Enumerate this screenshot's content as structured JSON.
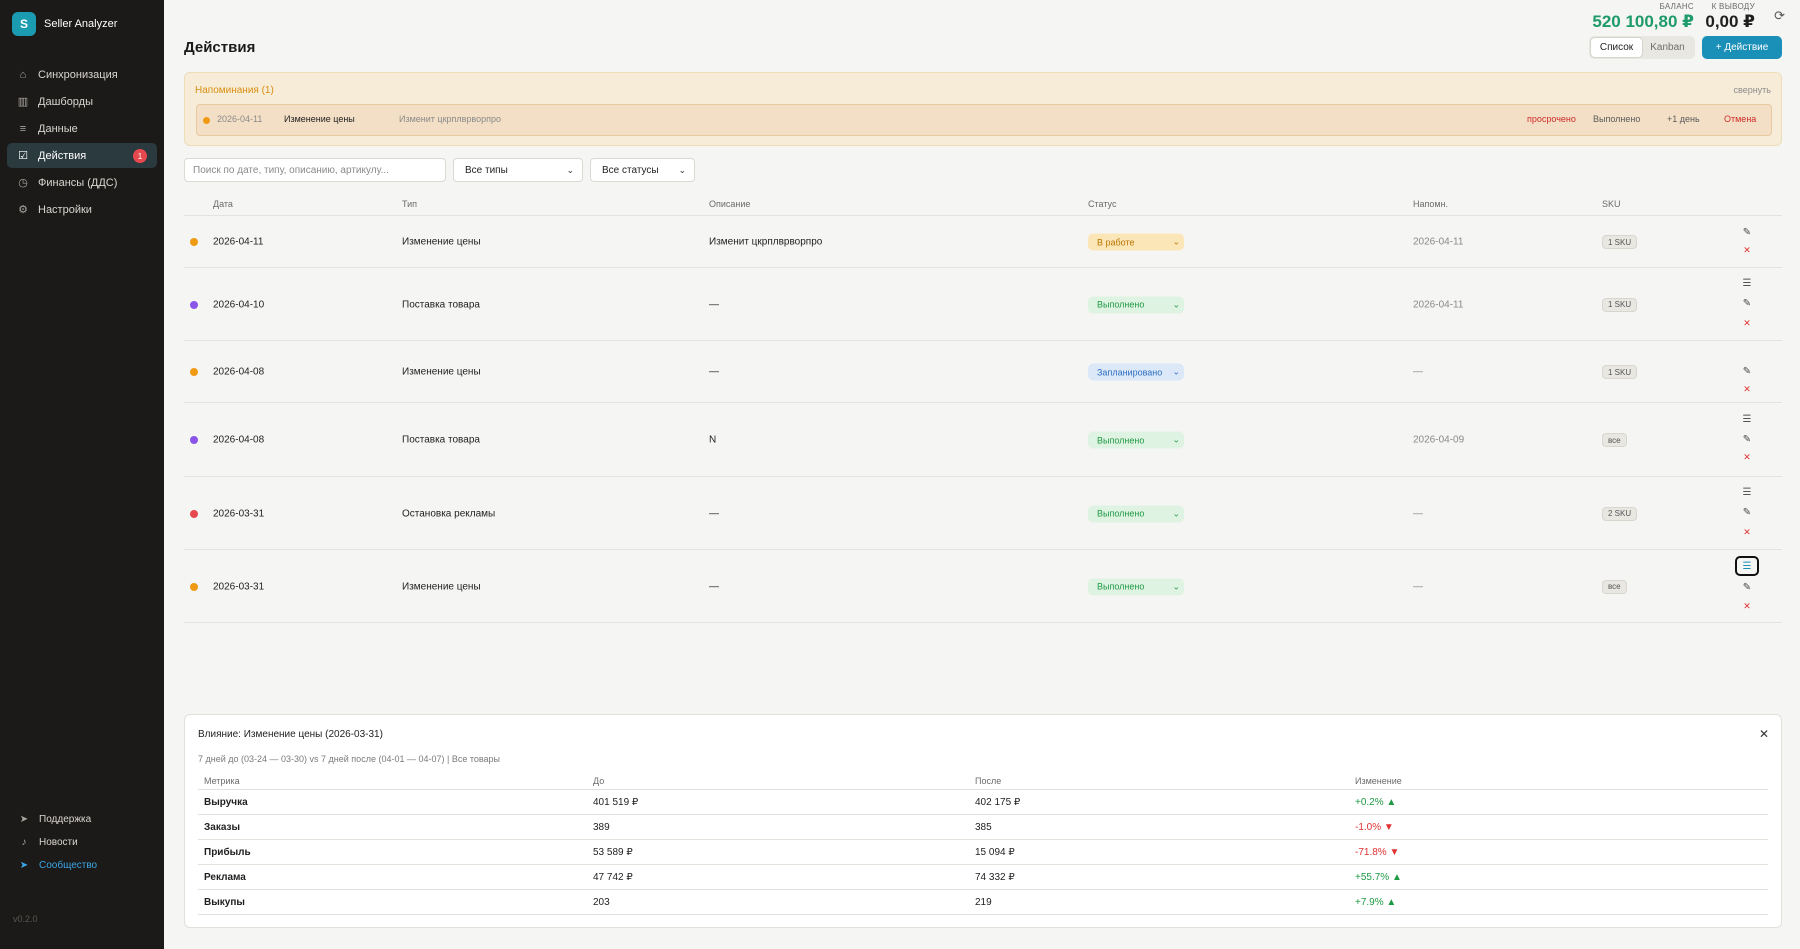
{
  "app": {
    "logo_letter": "S",
    "name": "Seller Analyzer",
    "version": "v0.2.0"
  },
  "sidebar": {
    "items": [
      {
        "label": "Синхронизация",
        "icon": "home-icon",
        "glyph": "⌂",
        "active": false
      },
      {
        "label": "Дашборды",
        "icon": "bar-chart-icon",
        "glyph": "▥",
        "active": false
      },
      {
        "label": "Данные",
        "icon": "list-icon",
        "glyph": "≡",
        "active": false
      },
      {
        "label": "Действия",
        "icon": "clipboard-check-icon",
        "glyph": "☑",
        "active": true,
        "badge": "1"
      },
      {
        "label": "Финансы (ДДС)",
        "icon": "clock-icon",
        "glyph": "◷",
        "active": false
      },
      {
        "label": "Настройки",
        "icon": "gear-icon",
        "glyph": "⚙",
        "active": false
      }
    ],
    "bottom": [
      {
        "label": "Поддержка",
        "icon": "send-icon",
        "glyph": "➤"
      },
      {
        "label": "Новости",
        "icon": "bell-icon",
        "glyph": "♪"
      },
      {
        "label": "Сообщество",
        "icon": "telegram-icon",
        "glyph": "➤",
        "accent": true
      }
    ]
  },
  "header": {
    "balance_caption": "БАЛАНС",
    "balance_value": "520 100,80 ₽",
    "withdraw_caption": "К ВЫВОДУ",
    "withdraw_value": "0,00 ₽",
    "page_title": "Действия",
    "view_list": "Список",
    "view_kanban": "Kanban",
    "add_label": "+ Действие"
  },
  "colors": {
    "accent": "#1a8fb8",
    "balance_green": "#1f9a6a",
    "danger": "#e03131",
    "success": "#1f9a45"
  },
  "reminders": {
    "title": "Напоминания (1)",
    "collapse_label": "свернуть",
    "items": [
      {
        "date": "2026-04-11",
        "type": "Изменение цены",
        "description": "Изменит цкрплврворпро",
        "overdue": "просрочено",
        "done": "Выполнено",
        "plus_day": "+1 день",
        "cancel": "Отмена"
      }
    ]
  },
  "filters": {
    "search_placeholder": "Поиск по дате, типу, описанию, артикулу...",
    "type_select": "Все типы",
    "status_select": "Все статусы"
  },
  "table": {
    "columns": {
      "date": "Дата",
      "type": "Тип",
      "description": "Описание",
      "status": "Статус",
      "remind": "Напомн.",
      "sku": "SKU"
    },
    "rows": [
      {
        "dot": "#ef9a12",
        "date": "2026-04-11",
        "type": "Изменение цены",
        "description": "Изменит цкрплврворпро",
        "status": "В работе",
        "status_kind": "work",
        "remind": "2026-04-11",
        "sku": "1 SKU",
        "has_list": false
      },
      {
        "dot": "#8a55e8",
        "date": "2026-04-10",
        "type": "Поставка товара",
        "description": "—",
        "status": "Выполнено",
        "status_kind": "done",
        "remind": "2026-04-11",
        "sku": "1 SKU",
        "has_list": true
      },
      {
        "dot": "#ef9a12",
        "date": "2026-04-08",
        "type": "Изменение цены",
        "description": "—",
        "status": "Запланировано",
        "status_kind": "plan",
        "remind": "—",
        "sku": "1 SKU",
        "has_list": false
      },
      {
        "dot": "#8a55e8",
        "date": "2026-04-08",
        "type": "Поставка товара",
        "description": "N",
        "status": "Выполнено",
        "status_kind": "done",
        "remind": "2026-04-09",
        "sku": "все",
        "has_list": true
      },
      {
        "dot": "#e5484d",
        "date": "2026-03-31",
        "type": "Остановка рекламы",
        "description": "—",
        "status": "Выполнено",
        "status_kind": "done",
        "remind": "—",
        "sku": "2 SKU",
        "has_list": true
      },
      {
        "dot": "#ef9a12",
        "date": "2026-03-31",
        "type": "Изменение цены",
        "description": "—",
        "status": "Выполнено",
        "status_kind": "done",
        "remind": "—",
        "sku": "все",
        "has_list": true,
        "list_focused": true
      }
    ]
  },
  "impact": {
    "title": "Влияние: Изменение цены (2026-03-31)",
    "subtitle": "7 дней до (03-24 — 03-30)  vs  7 дней после (04-01 — 04-07) | Все товары",
    "columns": {
      "metric": "Метрика",
      "before": "До",
      "after": "После",
      "change": "Изменение"
    },
    "rows": [
      {
        "metric": "Выручка",
        "before": "401 519 ₽",
        "after": "402 175 ₽",
        "change": "+0.2% ▲",
        "trend": "up"
      },
      {
        "metric": "Заказы",
        "before": "389",
        "after": "385",
        "change": "-1.0% ▼",
        "trend": "down"
      },
      {
        "metric": "Прибыль",
        "before": "53 589 ₽",
        "after": "15 094 ₽",
        "change": "-71.8% ▼",
        "trend": "down"
      },
      {
        "metric": "Реклама",
        "before": "47 742 ₽",
        "after": "74 332 ₽",
        "change": "+55.7% ▲",
        "trend": "up"
      },
      {
        "metric": "Выкупы",
        "before": "203",
        "after": "219",
        "change": "+7.9% ▲",
        "trend": "up"
      }
    ]
  }
}
